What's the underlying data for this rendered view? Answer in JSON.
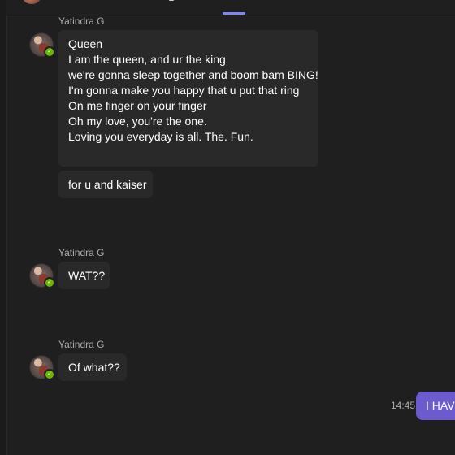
{
  "header": {
    "indicator_color": "#7f85f5"
  },
  "messages": [
    {
      "sender": "Yatindra G",
      "bubbles": [
        {
          "lines": [
            "Queen",
            "",
            "I am the queen, and ur the king",
            "we're gonna sleep together and boom bam BING!",
            "I'm gonna make you happy that u put that ring",
            "On me finger on your finger",
            "Oh my love, you're the one.",
            "Loving you everyday is all. The. Fun."
          ]
        },
        {
          "lines": [
            "for u and kaiser"
          ]
        }
      ]
    },
    {
      "sender": "Yatindra G",
      "bubbles": [
        {
          "lines": [
            "WAT??"
          ]
        }
      ]
    },
    {
      "sender": "Yatindra G",
      "bubbles": [
        {
          "lines": [
            "Of what??"
          ]
        }
      ]
    }
  ],
  "my_message": {
    "time": "14:45",
    "text": "I HAVE",
    "color": "#6b5bcf"
  },
  "status": {
    "presence_color": "#6bb700",
    "presence_icon": "check-icon"
  }
}
